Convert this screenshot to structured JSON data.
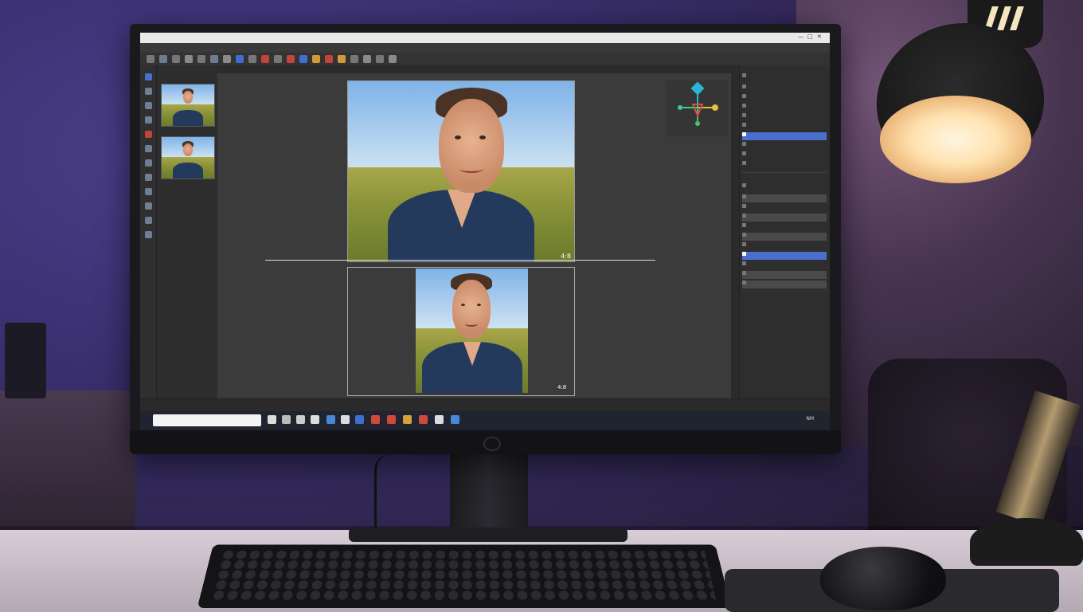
{
  "scene": {
    "caption": "",
    "description_hidden": ""
  },
  "app": {
    "title": "",
    "menu": [],
    "left_tabs": []
  },
  "filmstrip": {
    "items": []
  },
  "right_panel": {
    "rows": []
  },
  "status": {
    "zoom_top": "4:8",
    "zoom_bottom": "4:8"
  },
  "taskbar": {
    "search_placeholder": "",
    "clock": "NM"
  },
  "colors": {
    "wall": "#3a2f6e",
    "accent_select": "#4a6fcf",
    "lamp_glow": "#fff5e0"
  }
}
